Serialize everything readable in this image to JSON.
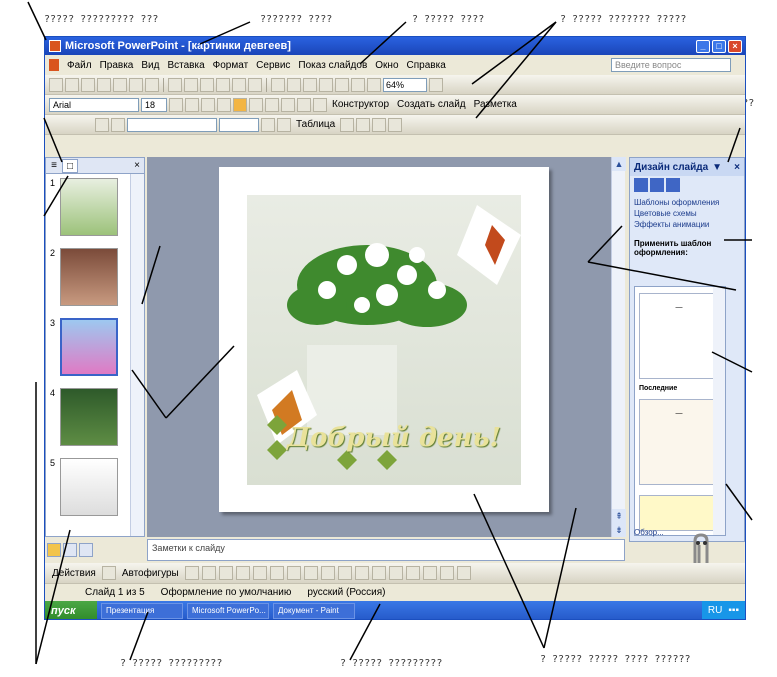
{
  "app": {
    "title": "Microsoft PowerPoint - [картинки девгеев]"
  },
  "menu": {
    "items": [
      "Файл",
      "Правка",
      "Вид",
      "Вставка",
      "Формат",
      "Сервис",
      "Показ слайдов",
      "Окно",
      "Справка"
    ],
    "ask_placeholder": "Введите вопрос"
  },
  "toolbar": {
    "zoom": "64%"
  },
  "format_toolbar": {
    "font": "Arial",
    "size": "18",
    "designer": "Конструктор",
    "new_slide": "Создать слайд",
    "layout": "Разметка"
  },
  "table_toolbar": {
    "table_label": "Таблица"
  },
  "slides_pane": {
    "numbers": [
      "1",
      "2",
      "3",
      "4",
      "5"
    ]
  },
  "slide": {
    "greeting": "Добрый день!"
  },
  "notes": {
    "placeholder": "Заметки к слайду"
  },
  "task_pane": {
    "title": "Дизайн слайда",
    "links": [
      "Шаблоны оформления",
      "Цветовые схемы",
      "Эффекты анимации"
    ],
    "apply_label": "Применить шаблон оформления:",
    "recent_label": "Последние",
    "footer_link": "Обзор..."
  },
  "drawing_toolbar": {
    "actions": "Действия",
    "autoshapes": "Автофигуры"
  },
  "status": {
    "slide_counter": "Слайд 1 из 5",
    "design": "Оформление по умолчанию",
    "language": "русский (Россия)"
  },
  "taskbar": {
    "start": "пуск",
    "tasks": [
      "Презентация",
      "Microsoft PowerPo...",
      "Документ - Paint"
    ],
    "lang": "RU"
  },
  "annotations": {
    "top": [
      "????? ????????? ???",
      "??????? ????",
      "? ????? ????",
      "? ????? ??????? ?????"
    ],
    "right_top": [
      "??? ??????? ???",
      "? ????? ????"
    ],
    "middle_left": "? ?????",
    "middle_right": "??????",
    "thumbs": "?????",
    "bottom": [
      "? ????? ?????????",
      "? ????? ?????????",
      "? ????? ????? ???? ??????"
    ]
  }
}
